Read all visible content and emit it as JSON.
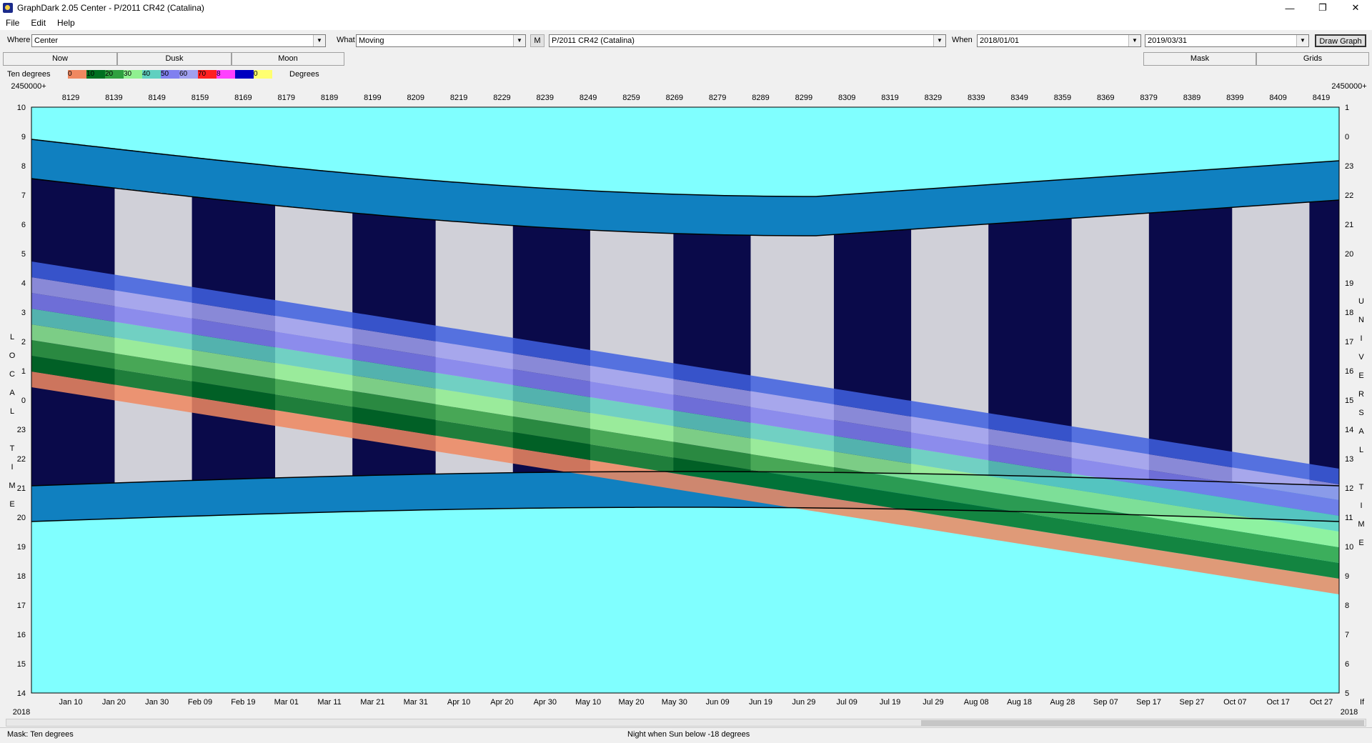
{
  "window": {
    "title": "GraphDark 2.05  Center  -  P/2011 CR42 (Catalina)",
    "min": "—",
    "max": "❐",
    "close": "✕"
  },
  "menu": [
    "File",
    "Edit",
    "Help"
  ],
  "toolbar": {
    "where_label": "Where",
    "where_value": "Center",
    "what_label": "What",
    "what_value": "Moving",
    "m_button": "M",
    "object_value": "P/2011 CR42 (Catalina)",
    "when_label": "When",
    "when_start": "2018/01/01",
    "when_end": "2019/03/31",
    "draw_button": "Draw Graph"
  },
  "buttons": {
    "now": "Now",
    "dusk": "Dusk",
    "moon": "Moon",
    "mask": "Mask",
    "grids": "Grids"
  },
  "legend": {
    "label": "Ten degrees",
    "swatches": [
      {
        "text": "0",
        "color": "#f08860"
      },
      {
        "text": "10",
        "color": "#007020"
      },
      {
        "text": "20",
        "color": "#30a040"
      },
      {
        "text": "30",
        "color": "#90f090"
      },
      {
        "text": "40",
        "color": "#60d0c0"
      },
      {
        "text": "50",
        "color": "#8080f0"
      },
      {
        "text": "60",
        "color": "#a0a0f0"
      },
      {
        "text": "70",
        "color": "#ff2020"
      },
      {
        "text": "8",
        "color": "#ff40ff"
      },
      {
        "text": "",
        "color": "#0000c0"
      },
      {
        "text": "0",
        "color": "#ffff70"
      }
    ],
    "unit": "Degrees"
  },
  "plot": {
    "top_left_label": "2450000+",
    "top_right_label": "2450000+",
    "jd_ticks": [
      "8129",
      "8139",
      "8149",
      "8159",
      "8169",
      "8179",
      "8189",
      "8199",
      "8209",
      "8219",
      "8229",
      "8239",
      "8249",
      "8259",
      "8269",
      "8279",
      "8289",
      "8299",
      "8309",
      "8319",
      "8329",
      "8339",
      "8349",
      "8359",
      "8369",
      "8379",
      "8389",
      "8399",
      "8409",
      "8419"
    ],
    "date_ticks": [
      "Jan 10",
      "Jan 20",
      "Jan 30",
      "Feb 09",
      "Feb 19",
      "Mar 01",
      "Mar 11",
      "Mar 21",
      "Mar 31",
      "Apr 10",
      "Apr 20",
      "Apr 30",
      "May 10",
      "May 20",
      "May 30",
      "Jun 09",
      "Jun 19",
      "Jun 29",
      "Jul 09",
      "Jul 19",
      "Jul 29",
      "Aug 08",
      "Aug 18",
      "Aug 28",
      "Sep 07",
      "Sep 17",
      "Sep 27",
      "Oct 07",
      "Oct 17",
      "Oct 27"
    ],
    "left_ticks": [
      "10",
      "9",
      "8",
      "7",
      "6",
      "5",
      "4",
      "3",
      "2",
      "1",
      "0",
      "23",
      "22",
      "21",
      "20",
      "19",
      "18",
      "17",
      "16",
      "15",
      "14"
    ],
    "right_ticks": [
      "1",
      "0",
      "23",
      "22",
      "21",
      "20",
      "19",
      "18",
      "17",
      "16",
      "15",
      "14",
      "13",
      "12",
      "11",
      "10",
      "9",
      "8",
      "7",
      "6",
      "5"
    ],
    "left_axis_letters": [
      "L",
      "O",
      "C",
      "A",
      "L",
      "",
      "T",
      "I",
      "M",
      "E"
    ],
    "right_axis_letters": [
      "U",
      "N",
      "I",
      "V",
      "E",
      "R",
      "S",
      "A",
      "L",
      "",
      "T",
      "I",
      "M",
      "E"
    ],
    "bottom_left_year": "2018",
    "bottom_right_year": "2018",
    "bottom_right_extra": "If",
    "colors": {
      "day_sky": "#80ffff",
      "night": "#0a0a4a",
      "twilight_blue": "#1080c0",
      "moon_gray": "#d0d0d8"
    }
  },
  "status": {
    "left": "Mask:  Ten degrees",
    "center": "Night when Sun below -18 degrees"
  }
}
